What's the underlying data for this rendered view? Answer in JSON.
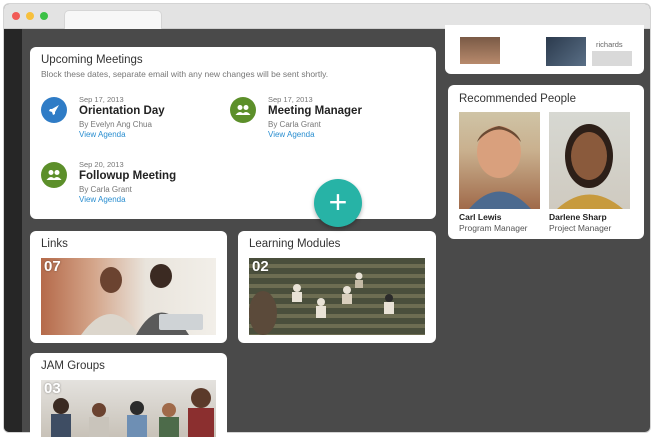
{
  "window": {
    "controls": [
      "close",
      "minimize",
      "maximize"
    ]
  },
  "upcoming": {
    "title": "Upcoming Meetings",
    "subtitle": "Block these dates, separate email with any new changes will be sent shortly.",
    "meetings": [
      {
        "date": "Sep 17, 2013",
        "name": "Orientation Day",
        "by": "By Evelyn Ang Chua",
        "link": "View Agenda",
        "icon": "rocket-icon",
        "color": "#2f7cc6"
      },
      {
        "date": "Sep 17, 2013",
        "name": "Meeting Manager",
        "by": "By Carla Grant",
        "link": "View Agenda",
        "icon": "group-icon",
        "color": "#5c8f2a"
      },
      {
        "date": "Sep 20, 2013",
        "name": "Followup Meeting",
        "by": "By Carla Grant",
        "link": "View Agenda",
        "icon": "group-icon",
        "color": "#5c8f2a"
      }
    ]
  },
  "links": {
    "title": "Links",
    "count": "07"
  },
  "learning": {
    "title": "Learning Modules",
    "count": "02"
  },
  "jam": {
    "title": "JAM Groups",
    "count": "03"
  },
  "recommended": {
    "title": "Recommended People",
    "people": [
      {
        "name": "Carl Lewis",
        "role": "Program Manager"
      },
      {
        "name": "Darlene Sharp",
        "role": "Project Manager"
      }
    ]
  },
  "top_partial": {
    "label": "richards"
  },
  "fab": {
    "label": "+"
  },
  "colors": {
    "accent": "#27b3a6",
    "link": "#2a8ed0",
    "background": "#4a4a4a"
  }
}
